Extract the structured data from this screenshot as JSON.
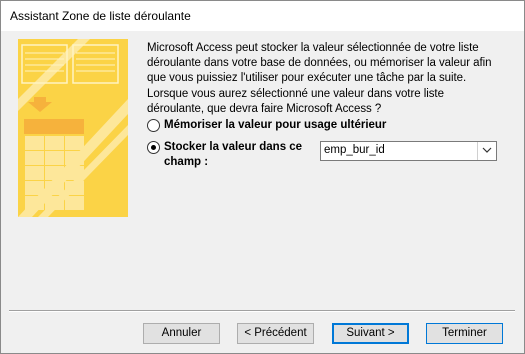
{
  "window": {
    "title": "Assistant Zone de liste déroulante"
  },
  "illustration": {
    "icon": "lookup-wizard-illustration",
    "background_color": "#fbd346",
    "accent_color": "#f6b23c"
  },
  "description": "Microsoft Access peut stocker la valeur sélectionnée de votre liste déroulante dans votre base de données, ou mémoriser la valeur afin que vous puissiez l'utiliser pour exécuter une tâche par la suite. Lorsque vous aurez sélectionné une valeur dans votre liste déroulante, que devra faire Microsoft Access ?",
  "options": [
    {
      "label": "Mémoriser la valeur pour usage ultérieur",
      "selected": false
    },
    {
      "label": "Stocker la valeur dans ce champ :",
      "selected": true
    }
  ],
  "field_combo": {
    "value": "emp_bur_id"
  },
  "buttons": {
    "cancel": "Annuler",
    "previous": "< Précédent",
    "next": "Suivant >",
    "finish": "Terminer"
  }
}
